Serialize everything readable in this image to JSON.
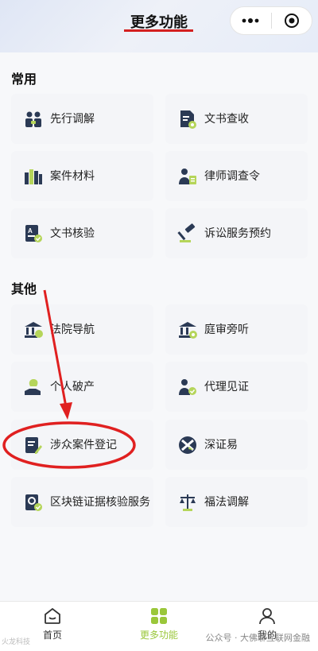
{
  "header": {
    "title": "更多功能"
  },
  "sections": {
    "common": {
      "title": "常用",
      "items": [
        {
          "label": "先行调解",
          "icon": "mediation-people-icon"
        },
        {
          "label": "文书查收",
          "icon": "document-receive-icon"
        },
        {
          "label": "案件材料",
          "icon": "case-materials-icon"
        },
        {
          "label": "律师调查令",
          "icon": "lawyer-order-icon"
        },
        {
          "label": "文书核验",
          "icon": "document-verify-icon"
        },
        {
          "label": "诉讼服务预约",
          "icon": "gavel-appointment-icon"
        }
      ]
    },
    "other": {
      "title": "其他",
      "items": [
        {
          "label": "法院导航",
          "icon": "court-navigation-icon"
        },
        {
          "label": "庭审旁听",
          "icon": "court-hearing-icon"
        },
        {
          "label": "个人破产",
          "icon": "personal-bankruptcy-icon"
        },
        {
          "label": "代理见证",
          "icon": "agent-witness-icon"
        },
        {
          "label": "涉众案件登记",
          "icon": "mass-case-register-icon"
        },
        {
          "label": "深证易",
          "icon": "szy-logo-icon"
        },
        {
          "label": "区块链证据核验服务",
          "icon": "blockchain-verify-icon"
        },
        {
          "label": "福法调解",
          "icon": "scales-icon"
        }
      ]
    }
  },
  "tabbar": {
    "tabs": [
      {
        "label": "首页",
        "icon": "home-icon"
      },
      {
        "label": "更多功能",
        "icon": "grid-icon"
      },
      {
        "label": "我的",
        "icon": "user-icon"
      }
    ],
    "active_color": "#9ac73a"
  },
  "watermark": {
    "left": "火龙科技",
    "right": "公众号 · 大佛聊互联网金融"
  },
  "colors": {
    "accent": "#9ac73a",
    "icon_dark": "#2b3a55",
    "annotation_red": "#d42020"
  }
}
